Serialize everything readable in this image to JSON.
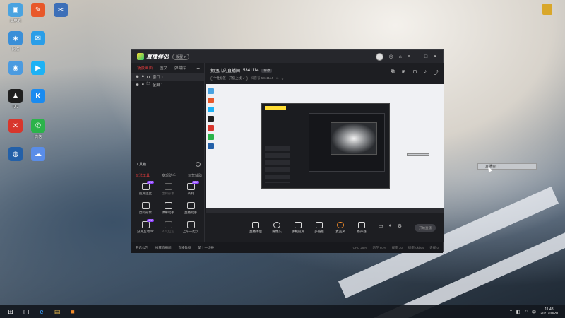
{
  "desktop": {
    "icons": [
      {
        "label": "此电脑",
        "color": "#4aa3e0",
        "glyph": "▣"
      },
      {
        "label": "",
        "color": "#e8582a",
        "glyph": "✎"
      },
      {
        "label": "",
        "color": "#3d6fb8",
        "glyph": "✂"
      },
      {
        "label": "网络",
        "color": "#3a8fd8",
        "glyph": "◈"
      },
      {
        "label": "",
        "color": "#2a9ee8",
        "glyph": "✉"
      },
      {
        "label": "",
        "color": "#4b9be0",
        "glyph": "◉"
      },
      {
        "label": "",
        "color": "#1db2f5",
        "glyph": "▶"
      },
      {
        "label": "QQ",
        "color": "#1f1f1f",
        "glyph": "♟"
      },
      {
        "label": "",
        "color": "#1a8bf0",
        "glyph": "K"
      },
      {
        "label": "",
        "color": "#d8362c",
        "glyph": "✕"
      },
      {
        "label": "微信",
        "color": "#2bb34a",
        "glyph": "✆"
      },
      {
        "label": "",
        "color": "#2360a8",
        "glyph": "◍"
      },
      {
        "label": "",
        "color": "#5a8de8",
        "glyph": "☁"
      }
    ],
    "top_right_icon_color": "#d9a72a"
  },
  "app": {
    "name": "直播伴侣",
    "version_badge": "版型 ▾",
    "window_controls": [
      "◎",
      "⌂",
      "≡",
      "–",
      "□",
      "✕"
    ],
    "left_tabs": [
      "场景画面",
      "图文",
      "弹幕库"
    ],
    "add_tab": "+",
    "sources": [
      {
        "label": "窗口 1"
      },
      {
        "label": "全屏 1"
      }
    ],
    "tools_title": "工具箱",
    "tool_tabs": [
      "玩法工具",
      "变现助手",
      "运营辅助"
    ],
    "tools": [
      {
        "label": "投屏连麦",
        "new": "NEW",
        "dim": false
      },
      {
        "label": "虚拟形象",
        "new": "",
        "dim": true
      },
      {
        "label": "录制",
        "new": "NEW",
        "dim": false
      },
      {
        "label": "虚拟形象",
        "new": "",
        "dim": false
      },
      {
        "label": "弹幕助手",
        "new": "",
        "dim": false
      },
      {
        "label": "直播助手",
        "new": "",
        "dim": false
      },
      {
        "label": "分屏互动PK",
        "new": "NEW",
        "dim": false
      },
      {
        "label": "人气红包",
        "new": "",
        "dim": true
      },
      {
        "label": "上车一起玩",
        "new": "",
        "dim": false
      }
    ],
    "stream": {
      "title": "拥团儿的直播间",
      "room_id": "5341114",
      "edit_label": "修改",
      "subtitle_chip": "个性标签 · 开播上线 ✓",
      "subtitle_text": "抖音号 5341114",
      "fans": "0",
      "head_icons": [
        "⧉",
        "⊞",
        "⊡",
        "♪",
        "⤴"
      ]
    },
    "bottom_controls": [
      {
        "label": "直播伴侣"
      },
      {
        "label": "摄像头"
      },
      {
        "label": "手机投屏"
      },
      {
        "label": "多链接"
      },
      {
        "label": "麦克风"
      },
      {
        "label": "扬声器"
      }
    ],
    "start_button": "开始直播",
    "status": {
      "left": [
        "开启公告",
        "推荐直播间",
        "直播数据",
        "第上一切换"
      ],
      "right": [
        "CPU 28%",
        "内存 60%",
        "帧率 30",
        "码率 0kbps",
        "丢帧 0"
      ]
    }
  },
  "tooltip_text": "直播窗口",
  "taskbar": {
    "items": [
      "⊞",
      "▢",
      "e",
      "▤",
      "■"
    ],
    "tray_icons": [
      "^",
      "◧",
      "♫",
      "中"
    ],
    "time": "11:48",
    "date": "2021/10/20"
  }
}
